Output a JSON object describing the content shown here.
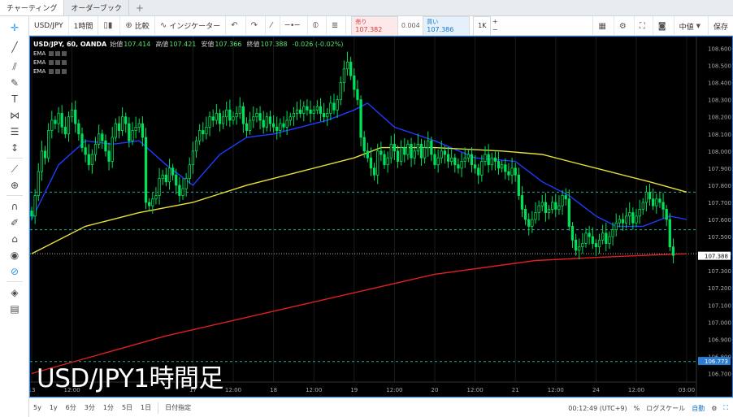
{
  "tabs": [
    {
      "label": "チャーティング",
      "active": true
    },
    {
      "label": "オーダーブック",
      "active": false
    }
  ],
  "toolbar": {
    "symbol": "USD/JPY",
    "interval": "1時間",
    "compare": "比較",
    "indicators": "インジケーター",
    "sell": {
      "label": "売り",
      "price": "107.382"
    },
    "spread": "0.004",
    "buy": {
      "label": "買い",
      "price": "107.386"
    },
    "lot": "1K",
    "price_source": "中値",
    "save": "保存"
  },
  "legend": {
    "title": "USD/JPY, 60, OANDA",
    "open_label": "始値",
    "open": "107.414",
    "high_label": "高値",
    "high": "107.421",
    "low_label": "安値",
    "low": "107.366",
    "close_label": "終値",
    "close": "107.388",
    "change": "-0.026 (-0.02%)",
    "indicators": [
      "EMA",
      "EMA",
      "EMA"
    ]
  },
  "overlay_title": "USD/JPY1時間足",
  "bottom": {
    "ranges": [
      "5y",
      "1y",
      "6分",
      "3分",
      "1分",
      "5日",
      "1日"
    ],
    "goto_date": "日付指定",
    "clock": "00:12:49 (UTC+9)",
    "percent": "%",
    "log": "ログスケール",
    "auto": "自動"
  },
  "colors": {
    "accent": "#2196f3",
    "candle": "#00e05a",
    "ema_fast": "#1e3cff",
    "ema_mid": "#e8e03a",
    "ema_slow": "#e02020",
    "hline": "#2ba7a0",
    "last_price_bg": "#ffffff",
    "blue_label_bg": "#2a7fd4"
  },
  "chart_data": {
    "type": "candlestick",
    "symbol": "USD/JPY",
    "timeframe": "60",
    "y_range": [
      106.65,
      108.65
    ],
    "y_ticks": [
      "108.600",
      "108.500",
      "108.400",
      "108.300",
      "108.200",
      "108.100",
      "108.000",
      "107.900",
      "107.800",
      "107.700",
      "107.600",
      "107.500",
      "107.400",
      "107.300",
      "107.200",
      "107.100",
      "107.000",
      "106.900",
      "106.800",
      "106.700"
    ],
    "x_ticks": [
      {
        "label": "13",
        "bar": 0
      },
      {
        "label": "12:00",
        "bar": 12
      },
      {
        "label": "17",
        "bar": 48
      },
      {
        "label": "12:00",
        "bar": 60
      },
      {
        "label": "18",
        "bar": 72
      },
      {
        "label": "12:00",
        "bar": 84
      },
      {
        "label": "19",
        "bar": 96
      },
      {
        "label": "12:00",
        "bar": 108
      },
      {
        "label": "20",
        "bar": 120
      },
      {
        "label": "12:00",
        "bar": 132
      },
      {
        "label": "21",
        "bar": 144
      },
      {
        "label": "12:00",
        "bar": 156
      },
      {
        "label": "24",
        "bar": 168
      },
      {
        "label": "12:00",
        "bar": 180
      },
      {
        "label": "03:00",
        "bar": 195
      }
    ],
    "bar_count": 195,
    "candles_close": [
      107.62,
      107.74,
      107.88,
      108.0,
      107.96,
      108.12,
      108.18,
      108.16,
      108.22,
      108.14,
      108.1,
      108.2,
      108.24,
      108.16,
      108.1,
      108.02,
      107.98,
      107.92,
      107.98,
      108.04,
      108.1,
      108.06,
      108.0,
      107.94,
      108.08,
      108.16,
      108.12,
      108.2,
      108.16,
      108.06,
      108.12,
      108.14,
      108.16,
      108.08,
      107.7,
      107.68,
      107.72,
      107.74,
      107.84,
      107.86,
      107.82,
      107.9,
      107.86,
      107.8,
      107.74,
      107.78,
      107.84,
      107.92,
      108.0,
      108.06,
      108.12,
      108.1,
      108.14,
      108.2,
      108.18,
      108.22,
      108.16,
      108.2,
      108.24,
      108.18,
      108.2,
      108.22,
      108.26,
      108.16,
      108.12,
      108.18,
      108.2,
      108.22,
      108.18,
      108.14,
      108.2,
      108.16,
      108.14,
      108.12,
      108.16,
      108.14,
      108.18,
      108.2,
      108.22,
      108.24,
      108.22,
      108.26,
      108.24,
      108.22,
      108.24,
      108.26,
      108.22,
      108.2,
      108.22,
      108.28,
      108.24,
      108.3,
      108.4,
      108.48,
      108.52,
      108.44,
      108.36,
      108.3,
      108.08,
      108.0,
      107.96,
      107.9,
      107.86,
      108.0,
      107.98,
      107.92,
      107.96,
      108.04,
      108.0,
      107.94,
      108.02,
      107.98,
      108.04,
      107.96,
      108.0,
      108.04,
      107.96,
      108.02,
      108.06,
      107.98,
      107.92,
      107.96,
      108.0,
      107.98,
      107.94,
      107.96,
      107.92,
      107.9,
      107.94,
      107.96,
      107.98,
      107.92,
      107.9,
      107.86,
      107.94,
      107.98,
      107.92,
      107.96,
      107.94,
      107.9,
      107.92,
      107.88,
      107.86,
      107.9,
      107.86,
      107.74,
      107.66,
      107.6,
      107.56,
      107.6,
      107.64,
      107.68,
      107.7,
      107.64,
      107.66,
      107.7,
      107.66,
      107.68,
      107.74,
      107.72,
      107.56,
      107.48,
      107.42,
      107.44,
      107.46,
      107.52,
      107.5,
      107.46,
      107.44,
      107.48,
      107.52,
      107.46,
      107.5,
      107.54,
      107.58,
      107.6,
      107.58,
      107.62,
      107.64,
      107.58,
      107.62,
      107.66,
      107.7,
      107.76,
      107.72,
      107.68,
      107.72,
      107.7,
      107.66,
      107.6,
      107.44,
      107.39
    ],
    "emas": [
      {
        "name": "EMA",
        "color": "#1e3cff",
        "points": [
          [
            0,
            107.6
          ],
          [
            8,
            107.92
          ],
          [
            16,
            108.06
          ],
          [
            24,
            108.04
          ],
          [
            32,
            108.06
          ],
          [
            40,
            107.92
          ],
          [
            48,
            107.8
          ],
          [
            56,
            107.98
          ],
          [
            64,
            108.08
          ],
          [
            72,
            108.1
          ],
          [
            80,
            108.14
          ],
          [
            88,
            108.18
          ],
          [
            96,
            108.24
          ],
          [
            100,
            108.28
          ],
          [
            108,
            108.14
          ],
          [
            120,
            108.06
          ],
          [
            132,
            107.96
          ],
          [
            144,
            107.94
          ],
          [
            152,
            107.82
          ],
          [
            160,
            107.74
          ],
          [
            168,
            107.62
          ],
          [
            174,
            107.56
          ],
          [
            182,
            107.56
          ],
          [
            190,
            107.62
          ],
          [
            195,
            107.6
          ]
        ]
      },
      {
        "name": "EMA",
        "color": "#e8e03a",
        "points": [
          [
            0,
            107.4
          ],
          [
            16,
            107.56
          ],
          [
            32,
            107.64
          ],
          [
            48,
            107.7
          ],
          [
            64,
            107.8
          ],
          [
            80,
            107.88
          ],
          [
            96,
            107.96
          ],
          [
            104,
            108.02
          ],
          [
            120,
            108.02
          ],
          [
            140,
            108.0
          ],
          [
            152,
            107.98
          ],
          [
            160,
            107.94
          ],
          [
            172,
            107.88
          ],
          [
            184,
            107.82
          ],
          [
            195,
            107.76
          ]
        ]
      },
      {
        "name": "EMA",
        "color": "#e02020",
        "points": [
          [
            0,
            106.7
          ],
          [
            40,
            106.92
          ],
          [
            80,
            107.1
          ],
          [
            120,
            107.28
          ],
          [
            150,
            107.36
          ],
          [
            170,
            107.38
          ],
          [
            195,
            107.4
          ]
        ]
      }
    ],
    "horizontal_lines": [
      107.76,
      107.54,
      107.4,
      106.77
    ],
    "last_price": "107.388",
    "blue_label": "106.773"
  }
}
